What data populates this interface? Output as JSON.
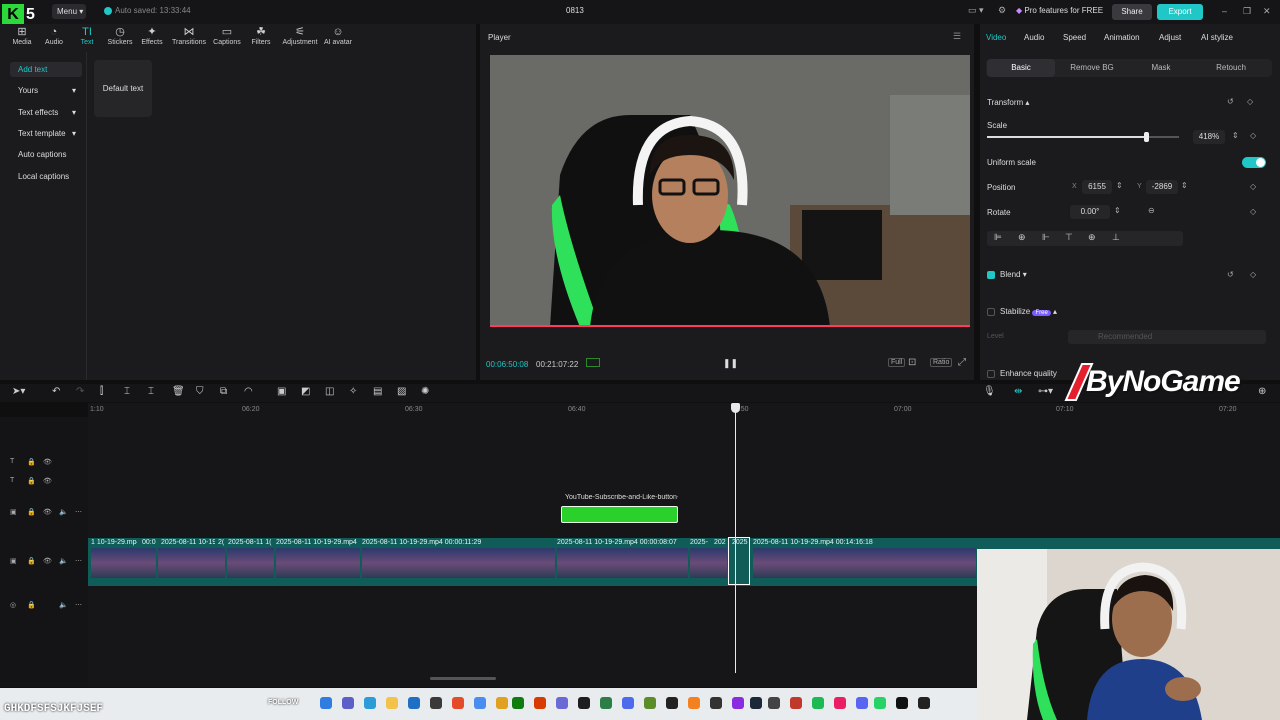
{
  "titlebar": {
    "menu_label": "Menu",
    "autosave": "Auto saved: 13:33:44",
    "project_title": "0813",
    "pro_label": "Pro features for FREE",
    "share_label": "Share",
    "export_label": "Export"
  },
  "toolbar": {
    "items": [
      "Media",
      "Audio",
      "Text",
      "Stickers",
      "Effects",
      "Transitions",
      "Captions",
      "Filters",
      "Adjustment",
      "AI avatar"
    ],
    "active": "Text"
  },
  "side_nav": {
    "items": [
      "Add text",
      "Yours",
      "Text effects",
      "Text template",
      "Auto captions",
      "Local captions"
    ]
  },
  "text_panel": {
    "card_label": "Default text"
  },
  "player": {
    "title": "Player",
    "current_time": "00:06:50:08",
    "total_time": "00:21:07:22",
    "full_label": "Full",
    "ratio_label": "Ratio"
  },
  "inspector": {
    "tabs": [
      "Video",
      "Audio",
      "Speed",
      "Animation",
      "Adjust",
      "AI stylize"
    ],
    "subtabs": [
      "Basic",
      "Remove BG",
      "Mask",
      "Retouch"
    ],
    "transform_label": "Transform",
    "scale_label": "Scale",
    "scale_value": "418%",
    "scale_fraction": 0.83,
    "uniform_scale_label": "Uniform scale",
    "position_label": "Position",
    "x_label": "X",
    "x_value": "6155",
    "y_label": "Y",
    "y_value": "-2869",
    "rotate_label": "Rotate",
    "rotate_value": "0.00°",
    "blend_label": "Blend",
    "stabilize_label": "Stabilize",
    "free_badge": "Free",
    "level_label": "Level",
    "level_value": "Recommended",
    "enhance_label": "Enhance quality"
  },
  "timeline": {
    "ruler_ticks": [
      "1:10",
      "06:20",
      "06:30",
      "06:40",
      "06:50",
      "07:00",
      "07:10",
      "07:20"
    ],
    "sticker_label": "YouTube-Subscribe-and-Like-button-",
    "clip_labels": [
      "1 10-19-29.mp4",
      "00:0",
      "2025-08-11 10-19",
      "2(",
      "2025-08-11 1(",
      "2025-08-11 10-19-29.mp4",
      "2025-08-11 10-19-29.mp4   00:00:11:29",
      "2025-08-11 10-19-29.mp4   00:00:08:07",
      "2025-",
      "202",
      "2025",
      "2025-08-11 10-19-29.mp4   00:14:16:18"
    ]
  },
  "overlay": {
    "watermark": "ByNoGame",
    "ticker": "GHKDFSFSJKFJSEF",
    "follow": "FOLLOW"
  },
  "colors": {
    "accent": "#21c7c7",
    "sticker_green": "#2ad12a",
    "track": "#0f5c59"
  }
}
